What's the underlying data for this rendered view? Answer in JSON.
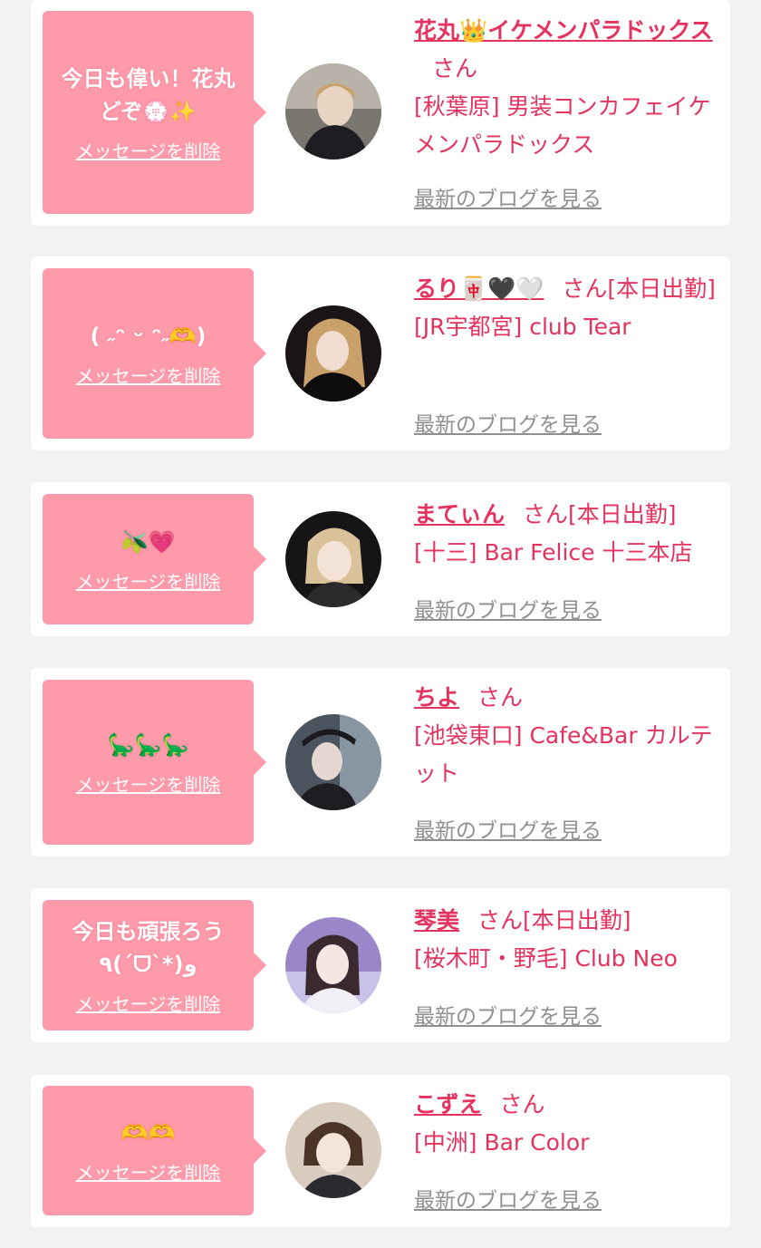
{
  "colors": {
    "page_background": "#f2f2f2",
    "card_background": "#ffffff",
    "bubble": "#ff9aab",
    "accent_text": "#e4335f",
    "link_gray": "#909090"
  },
  "delete_label": "メッセージを削除",
  "blog_label": "最新のブログを見る",
  "san_label": "さん",
  "favorites": [
    {
      "message": "今日も偉い！花丸どぞ💮✨",
      "name": "花丸👑イケメンパラドックス",
      "status": "",
      "shop": "[秋葉原] 男装コンカフェイケメンパラドックス",
      "avatar_icon": "avatar-photo"
    },
    {
      "message": "( ˶ᵔ ᵕ ᵔ˶🫶)",
      "name": "るり🀄🖤🤍",
      "status": "[本日出勤]",
      "shop": "[JR宇都宮] club Tear",
      "avatar_icon": "avatar-photo"
    },
    {
      "message": "🫒💗",
      "name": "まてぃん",
      "status": "[本日出勤]",
      "shop": "[十三] Bar Felice 十三本店",
      "avatar_icon": "avatar-photo"
    },
    {
      "message": "🦕🦕🦕",
      "name": "ちよ",
      "status": "",
      "shop": "[池袋東口] Cafe&Bar カルテット",
      "avatar_icon": "avatar-photo"
    },
    {
      "message": "今日も頑張ろう٩(ˊᗜˋ*)و",
      "name": "琴美",
      "status": "[本日出勤]",
      "shop": "[桜木町・野毛] Club Neo",
      "avatar_icon": "avatar-photo"
    },
    {
      "message": "🫶🫶",
      "name": "こずえ",
      "status": "",
      "shop": "[中洲] Bar Color",
      "avatar_icon": "avatar-photo"
    }
  ]
}
